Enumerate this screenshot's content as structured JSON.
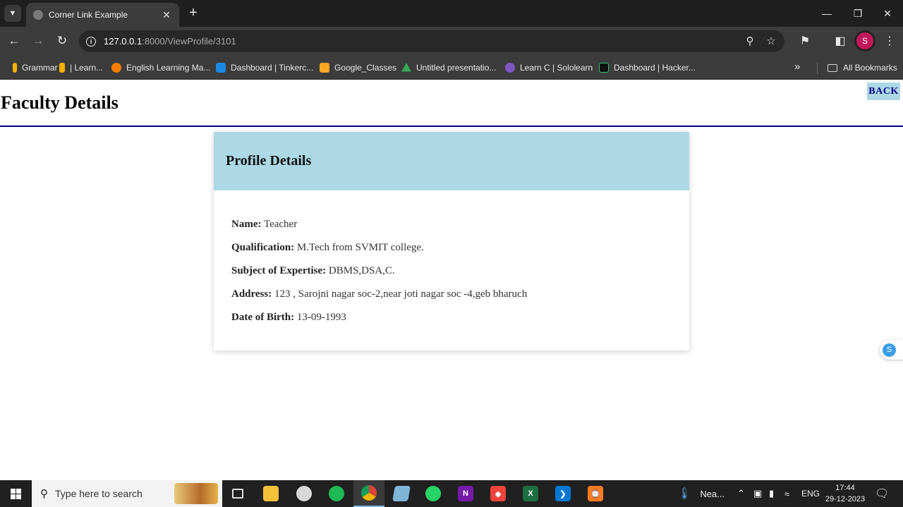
{
  "browser": {
    "tab_title": "Corner Link Example",
    "url_host": "127.0.0.1",
    "url_rest": ":8000/ViewProfile/3101",
    "profile_initial": "S",
    "bookmarks": [
      {
        "label": "Grammar",
        "icon": "bookmark-icon",
        "color": "#f4b400"
      },
      {
        "label": "| Learn...",
        "icon": "bookmark-icon",
        "color": "#f4b400"
      },
      {
        "label": "English Learning Ma...",
        "icon": "owl-icon",
        "color": "#f57c00"
      },
      {
        "label": "Dashboard | Tinkerc...",
        "icon": "grid-icon",
        "color": "#1e88e5"
      },
      {
        "label": "Google_Classes",
        "icon": "classroom-icon",
        "color": "#f9a825"
      },
      {
        "label": "Untitled presentatio...",
        "icon": "drive-icon",
        "color": "#34a853"
      },
      {
        "label": "Learn C | Sololearn",
        "icon": "sololearn-icon",
        "color": "#7e57c2"
      },
      {
        "label": "Dashboard | Hacker...",
        "icon": "hackerrank-icon",
        "color": "#1b1b1b"
      }
    ],
    "all_bookmarks": "All Bookmarks"
  },
  "page": {
    "title": "Faculty Details",
    "back_label": "BACK",
    "card_heading": "Profile Details",
    "fields": [
      {
        "label": "Name:",
        "value": " Teacher"
      },
      {
        "label": "Qualification:",
        "value": " M.Tech from SVMIT college."
      },
      {
        "label": "Subject of Expertise:",
        "value": " DBMS,DSA,C."
      },
      {
        "label": "Address:",
        "value": " 123 , Sarojni nagar soc-2,near joti nagar soc -4,geb bharuch"
      },
      {
        "label": "Date of Birth:",
        "value": " 13-09-1993"
      }
    ],
    "side_widget_letter": "S"
  },
  "taskbar": {
    "search_placeholder": "Type here to search",
    "weather_text": "Nea...",
    "language": "ENG",
    "time": "17:44",
    "date": "29-12-2023"
  },
  "colors": {
    "accent_blue": "#add8e6",
    "navy": "#000080"
  }
}
